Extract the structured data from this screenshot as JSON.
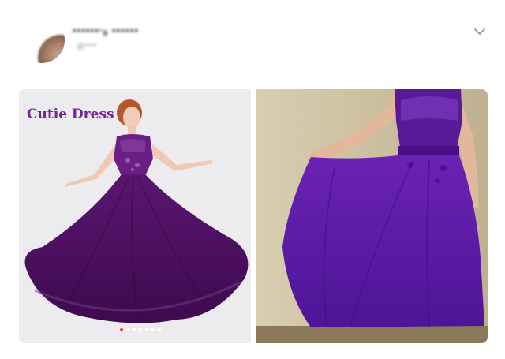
{
  "post": {
    "author_name": "******'s ******",
    "author_handle": "@****"
  },
  "media": {
    "left_caption": "Cutie Dress",
    "carousel": {
      "count": 7,
      "active_index": 0
    }
  },
  "colors": {
    "brand": "#7a1f9a",
    "dress_dark": "#4a0f5e",
    "dress_bright": "#6a1fb0",
    "carousel_active": "#e04848"
  },
  "icons": {
    "menu": "chevron-down-icon"
  }
}
